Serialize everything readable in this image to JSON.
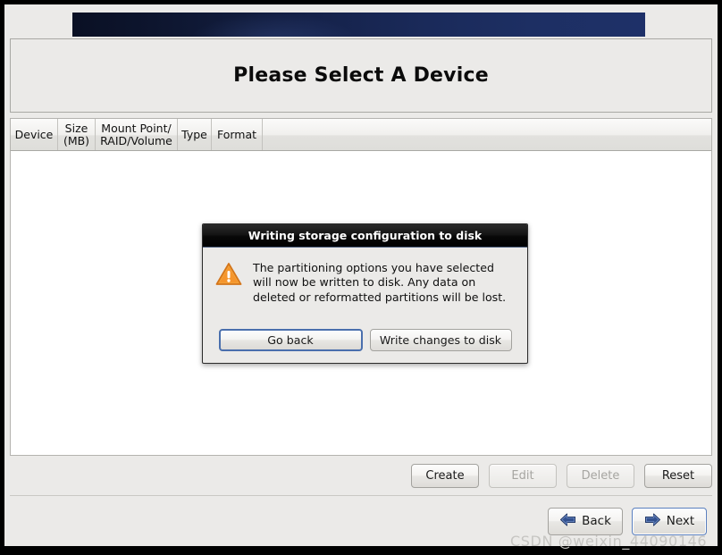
{
  "window": {
    "title": "Please Select A Device",
    "banner_gradient_from": "#0a1024",
    "banner_gradient_to": "#1e3068",
    "background": "#ebeae8"
  },
  "device_table": {
    "columns": [
      {
        "label": "Device",
        "width": 53
      },
      {
        "label": "Size\n(MB)",
        "width": 42
      },
      {
        "label": "Mount Point/\nRAID/Volume",
        "width": 92
      },
      {
        "label": "Type",
        "width": 38
      },
      {
        "label": "Format",
        "width": 57
      }
    ],
    "rows": []
  },
  "action_buttons": [
    {
      "label": "Create",
      "name": "create-button",
      "disabled": false
    },
    {
      "label": "Edit",
      "name": "edit-button",
      "disabled": true
    },
    {
      "label": "Delete",
      "name": "delete-button",
      "disabled": true
    },
    {
      "label": "Reset",
      "name": "reset-button",
      "disabled": false
    }
  ],
  "nav_buttons": {
    "back": {
      "label": "Back",
      "icon": "arrow-left-icon",
      "color": "#33518f"
    },
    "next": {
      "label": "Next",
      "icon": "arrow-right-icon",
      "color": "#33518f",
      "focused": true
    }
  },
  "dialog": {
    "title": "Writing storage configuration to disk",
    "icon": "warning-triangle-icon",
    "icon_color": "#f0922b",
    "message": "The partitioning options you have selected will now be written to disk.  Any data on deleted or reformatted partitions will be lost.",
    "buttons": {
      "go_back": {
        "label": "Go back",
        "default": true
      },
      "write_changes": {
        "label": "Write changes to disk",
        "default": false
      }
    }
  },
  "watermark": {
    "text": "CSDN @weixin_44090146"
  }
}
